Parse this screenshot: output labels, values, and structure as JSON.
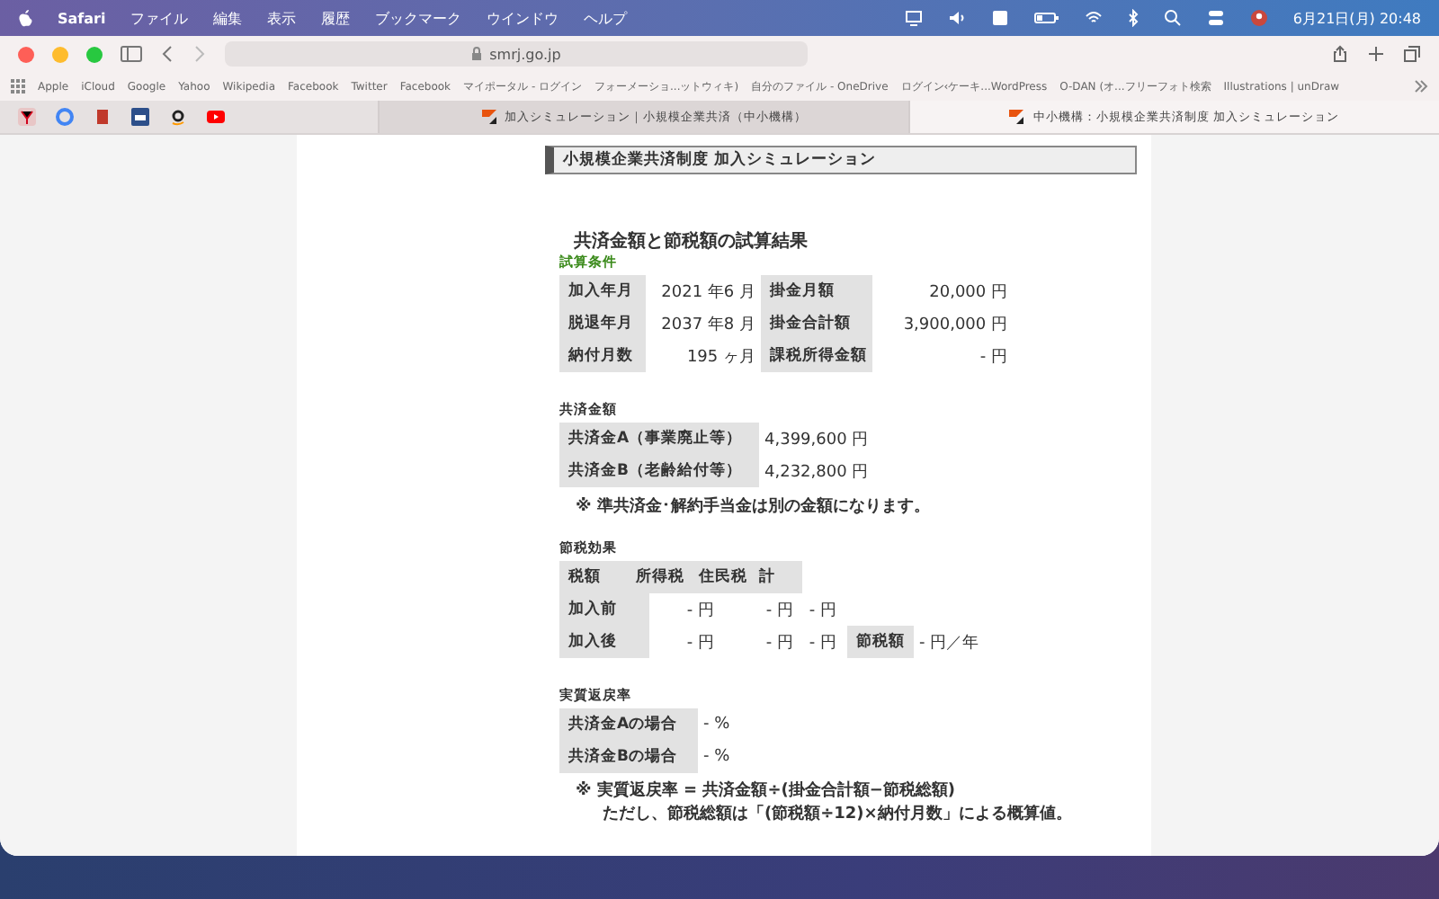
{
  "menu_bar": {
    "app": "Safari",
    "items": [
      "ファイル",
      "編集",
      "表示",
      "履歴",
      "ブックマーク",
      "ウインドウ",
      "ヘルプ"
    ],
    "clock": "6月21日(月)  20:48"
  },
  "browser": {
    "address": "smrj.go.jp",
    "bookmarks": [
      "Apple",
      "iCloud",
      "Google",
      "Yahoo",
      "Wikipedia",
      "Facebook",
      "Twitter",
      "Facebook",
      "マイポータル - ログイン",
      "フォーメーショ...ットウィキ)",
      "自分のファイル - OneDrive",
      "ログイン‹ケーキ...WordPress",
      "O-DAN (オ...フリーフォト検索",
      "Illustrations | unDraw"
    ],
    "tabs": [
      {
        "title": "加入シミュレーション｜小規模企業共済（中小機構）",
        "selected": false
      },
      {
        "title": "中小機構：小規模企業共済制度  加入シミュレーション",
        "selected": true
      }
    ]
  },
  "page": {
    "header": "小規模企業共済制度 加入シミュレーション",
    "result_title": "共済金額と節税額の試算結果",
    "conditions": {
      "title": "試算条件",
      "rows": [
        [
          "加入年月",
          "2021 年6 月",
          "掛金月額",
          "20,000 円"
        ],
        [
          "脱退年月",
          "2037 年8 月",
          "掛金合計額",
          "3,900,000 円"
        ],
        [
          "納付月数",
          "195 ヶ月",
          "課税所得金額",
          "- 円"
        ]
      ]
    },
    "amounts": {
      "title": "共済金額",
      "rows": [
        {
          "label": "共済金A（事業廃止等）",
          "value": "4,399,600 円"
        },
        {
          "label": "共済金B（老齢給付等）",
          "value": "4,232,800 円"
        }
      ]
    },
    "amount_note": "※ 準共済金･解約手当金は別の金額になります。",
    "tax_effect": {
      "title": "節税効果",
      "headers": [
        "税額",
        "所得税",
        "住民税",
        "計"
      ],
      "rows": [
        {
          "label": "加入前",
          "cells": [
            "- 円",
            "- 円",
            "- 円"
          ]
        },
        {
          "label": "加入後",
          "cells": [
            "- 円",
            "- 円",
            "- 円"
          ],
          "saving_label": "節税額",
          "saving_value": "- 円／年"
        }
      ]
    },
    "return_rate": {
      "title": "実質返戻率",
      "rows": [
        {
          "label": "共済金Aの場合",
          "value": "- %"
        },
        {
          "label": "共済金Bの場合",
          "value": "- %"
        }
      ]
    },
    "notes": [
      "※ 実質返戻率 = 共済金額÷(掛金合計額−節税総額)",
      "ただし、節税総額は「(節税額÷12)×納付月数」による概算値。"
    ]
  }
}
